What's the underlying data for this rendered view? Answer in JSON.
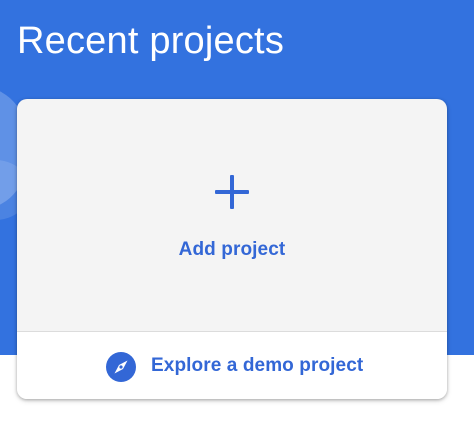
{
  "header": {
    "title": "Recent projects"
  },
  "card": {
    "add_icon": "plus-icon",
    "add_label": "Add project",
    "demo_icon": "compass-icon",
    "demo_label": "Explore a demo project"
  },
  "colors": {
    "hero_background": "#3372df",
    "card_background": "#f4f4f4",
    "accent": "#3367d6",
    "demo_row_background": "#ffffff"
  }
}
